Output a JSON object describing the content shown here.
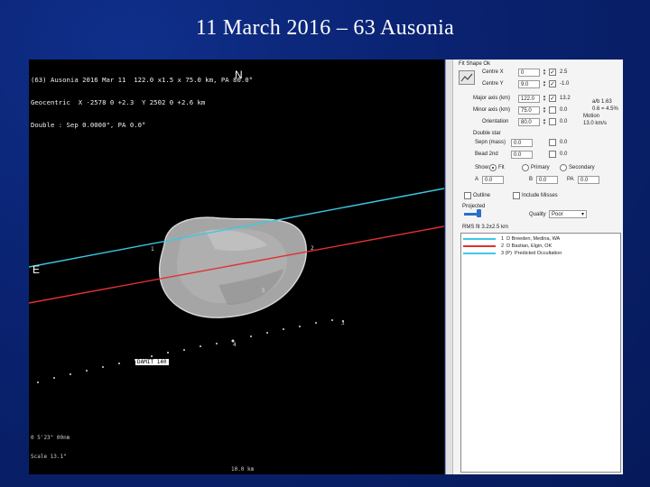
{
  "slide": {
    "title": "11 March 2016 – 63 Ausonia"
  },
  "viewport": {
    "info_lines": [
      "(63) Ausonia 2016 Mar 11  122.0 x1.5 x 75.0 km, PA 80.0°",
      "Geocentric  X -2578 0 +2.3  Y 2502 0 +2.6 km",
      "Double : Sep 0.0000\", PA 0.0°"
    ],
    "north_label": "N",
    "east_label": "E",
    "star_label": "DAMIT 140",
    "chord_numbers": [
      "1",
      "2",
      "3",
      "4",
      "5"
    ],
    "bottom_left": [
      "0 5'23\" 00nm",
      "Scale 13.1\""
    ],
    "bottom_mid": "10.0 km"
  },
  "panel": {
    "header": "Fit Shape Ok",
    "rows": [
      {
        "label": "Centre X",
        "value": "0",
        "check_label": "2.5",
        "checked": true
      },
      {
        "label": "Centre Y",
        "value": "9.0",
        "check_label": "-1.0",
        "checked": true
      },
      {
        "label": "Major axis (km)",
        "value": "122.0",
        "check_label": "13.2",
        "checked": true
      },
      {
        "label": "Minor axis (km)",
        "value": "75.0",
        "check_label": "0.0",
        "checked": false
      },
      {
        "label": "Orientation",
        "value": "80.0",
        "check_label": "0.0",
        "checked": false
      }
    ],
    "side_info": [
      "a/b 1.63",
      "0.6 = 4.5%",
      "Motion",
      "13.0 km/s"
    ],
    "double_star_label": "Double star",
    "double_rows": [
      {
        "label": "Sepn (mass)",
        "value": "0.0",
        "check_label": "0.0"
      },
      {
        "label": "Bead 2nd",
        "value": "0.0",
        "check_label": "0.0"
      }
    ],
    "show_label": "Show:",
    "show_options": [
      "Fit",
      "Primary",
      "Secondary"
    ],
    "a_label": "A",
    "a_value": "0.0",
    "b_label": "B",
    "b_value": "0.0",
    "pa_label": "PA",
    "pa_value": "0.0",
    "outlines_label": "Outline",
    "include_misses_label": "Include Misses",
    "projection_label": "Projected",
    "quality_label": "Quality",
    "quality_value": "Poor",
    "fit_summary": "RMS fit 3.2±2.5 km",
    "legend": [
      {
        "num": "1",
        "text": "D Breeden, Medina, WA",
        "color": "#3cc8e6"
      },
      {
        "num": "2",
        "text": "D Bastian, Elgin, OK",
        "color": "#e03030"
      },
      {
        "num": "3 (P)",
        "text": "Predicted Occultation",
        "color": "#3cc8e6"
      }
    ]
  },
  "colors": {
    "background": "#0a2372",
    "viewport_bg": "#000000",
    "chord_cyan": "#3cc8e6",
    "chord_red": "#e03030",
    "asteroid": "#9a9a9a"
  }
}
